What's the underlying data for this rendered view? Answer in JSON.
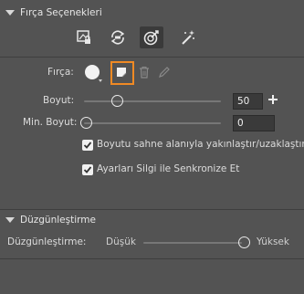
{
  "brush_options": {
    "title": "Fırça Seçenekleri",
    "tools": [
      {
        "icon": "lock-brush-icon",
        "selected": false
      },
      {
        "icon": "sync-brush-icon",
        "selected": false
      },
      {
        "icon": "target-brush-icon",
        "selected": true
      },
      {
        "icon": "magic-brush-icon",
        "selected": false
      }
    ],
    "brush_label": "Fırça:",
    "size_label": "Boyut:",
    "size_value": "50",
    "min_size_label": "Min. Boyut:",
    "min_size_value": "0",
    "checkbox_zoom": {
      "label": "Boyutu sahne alanıyla yakınlaştır/uzaklaştır",
      "checked": true
    },
    "checkbox_sync": {
      "label": "Ayarları Silgi ile Senkronize Et",
      "checked": true
    }
  },
  "smoothing": {
    "title": "Düzgünleştirme",
    "label": "Düzgünleştirme:",
    "low_label": "Düşük",
    "high_label": "Yüksek",
    "level": 1.0
  },
  "colors": {
    "panel_bg": "#535353",
    "accent_orange": "#f08a24"
  }
}
